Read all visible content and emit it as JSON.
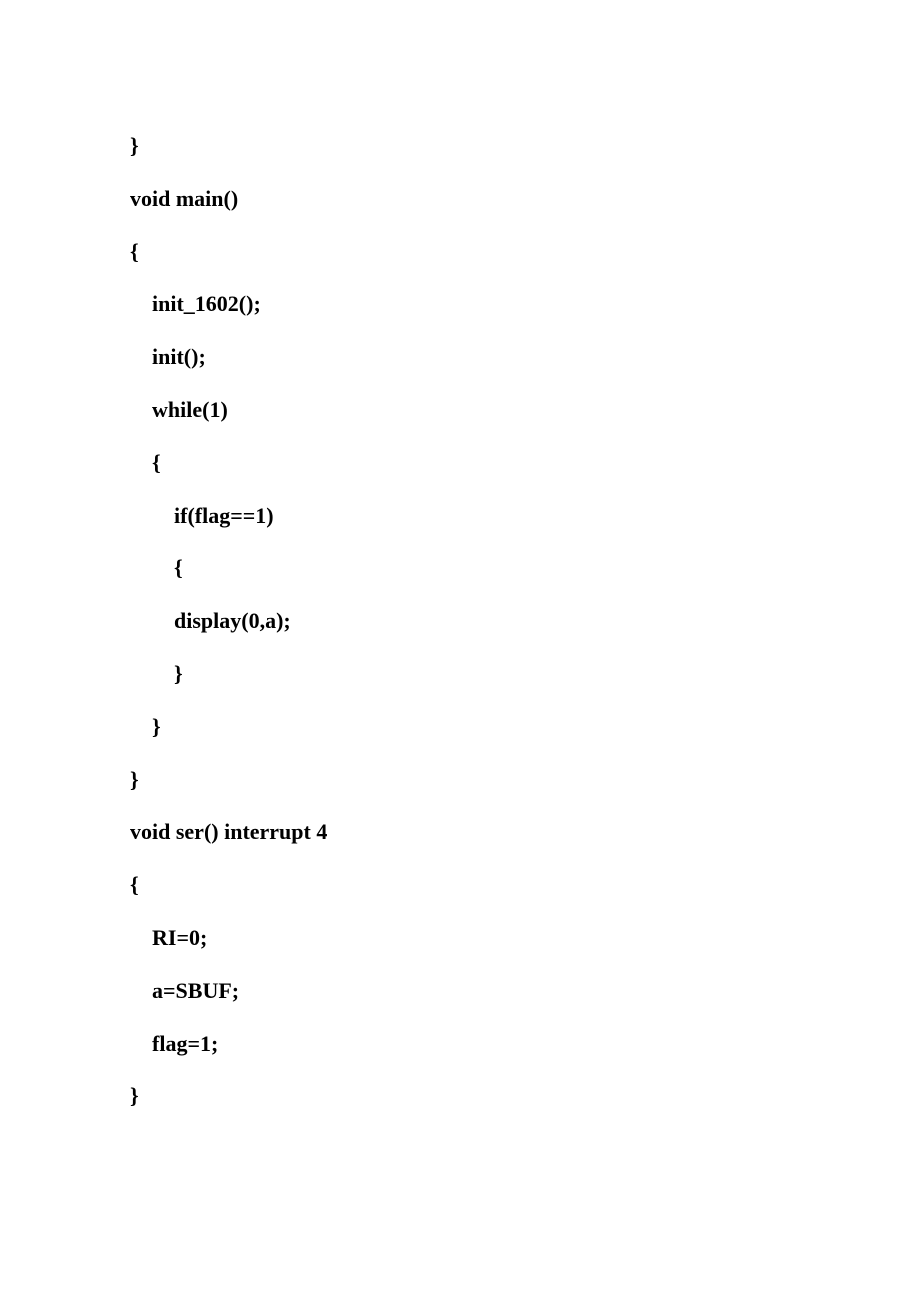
{
  "code": {
    "lines": [
      "}",
      "void main()",
      "{",
      "    init_1602();",
      "    init();",
      "    while(1)",
      "    {",
      "        if(flag==1)",
      "        {",
      "        display(0,a);",
      "        }",
      "    }",
      "}",
      "void ser() interrupt 4",
      "{",
      "    RI=0;",
      "    a=SBUF;",
      "    flag=1;",
      "}"
    ]
  }
}
